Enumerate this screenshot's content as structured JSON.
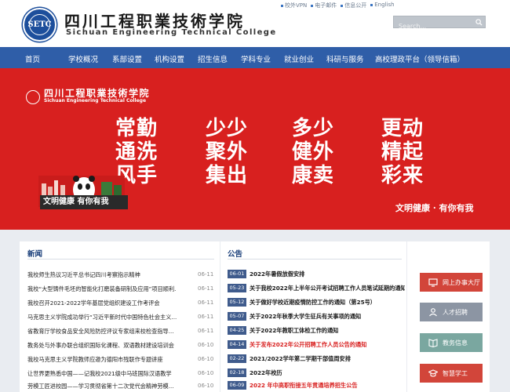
{
  "header": {
    "logo_cn": "四川工程职業技術学院",
    "logo_en": "Sichuan Engineering Technical College",
    "seal_text": "SETC",
    "top_links": [
      "校外VPN",
      "电子邮件",
      "信息公开",
      "English"
    ],
    "search_placeholder": "Search..."
  },
  "nav": {
    "items": [
      "首页",
      "学校概况",
      "系部设置",
      "机构设置",
      "招生信息",
      "学科专业",
      "就业创业",
      "科研与服务",
      "高校理政平台（领导信箱）"
    ]
  },
  "banner": {
    "logo_cn": "四川工程职業技術学院",
    "logo_en": "Sichuan Engineering Technical College",
    "slogan_rows": [
      [
        "常勤",
        "少少",
        "多少",
        "更动"
      ],
      [
        "通洗",
        "聚外",
        "健外",
        "精起"
      ],
      [
        "风手",
        "集出",
        "康卖",
        "彩来"
      ]
    ],
    "caption": "文明健康 有你有我",
    "right_slogan": "文明健康 · 有你有我"
  },
  "news": {
    "title": "新闻",
    "items": [
      {
        "title": "我校师生热议习近平总书记四川考察指示精神",
        "date": "06-11"
      },
      {
        "title": "我校“大型铸件毛坯的智能化打磨装备研制及应用”项目顺利...",
        "date": "06-11"
      },
      {
        "title": "我校召开2021-2022学年基层党组织建设工作考评会",
        "date": "06-11"
      },
      {
        "title": "马克思主义学院成功举行“习近平新时代中国特色社会主义...",
        "date": "06-11"
      },
      {
        "title": "省教育厅学校食品安全风险防控评议专家组来校检查指导...",
        "date": "06-11"
      },
      {
        "title": "教务处与外事办联合组织国际化课程、双语教材建设培训会",
        "date": "06-10"
      },
      {
        "title": "我校马克思主义学院教师应邀为德阳市残联作专题讲座",
        "date": "06-10"
      },
      {
        "title": "让世界更熟悉中国——记我校2021级中马班国际汉语教学",
        "date": "06-10"
      },
      {
        "title": "劳模工匠进校园——学习贯彻省第十二次党代会精神劳模...",
        "date": "06-10"
      }
    ]
  },
  "notices": {
    "title": "公告",
    "items": [
      {
        "date": "06-01",
        "title": "2022年暑假放假安排",
        "highlight": false
      },
      {
        "date": "05-23",
        "title": "关于我校2022年上半年公开考试招聘工作人员笔试延期的通知",
        "highlight": false
      },
      {
        "date": "05-12",
        "title": "关于做好学校近期疫情防控工作的通知（第25号）",
        "highlight": false
      },
      {
        "date": "05-07",
        "title": "关于2022年秋季大学生征兵有关事项的通知",
        "highlight": false
      },
      {
        "date": "04-25",
        "title": "关于2022年教职工体检工作的通知",
        "highlight": false
      },
      {
        "date": "04-14",
        "title": "关于发布2022年公开招聘工作人员公告的通知",
        "highlight": true
      },
      {
        "date": "02-22",
        "title": "2021/2022学年第二学期干部值周安排",
        "highlight": false
      },
      {
        "date": "02-18",
        "title": "2022年校历",
        "highlight": false
      },
      {
        "date": "06-09",
        "title": "2022 年中高职衔接五年贯通培养招生公告",
        "highlight": true
      }
    ]
  },
  "side": {
    "buttons": [
      {
        "label": "网上办事大厅",
        "color": "#d2453a",
        "icon": "monitor-icon"
      },
      {
        "label": "人才招聘",
        "color": "#8c95a3",
        "icon": "person-icon"
      },
      {
        "label": "教务信息",
        "color": "#7aa7a0",
        "icon": "book-icon"
      },
      {
        "label": "智慧学工",
        "color": "#d2453a",
        "icon": "cap-icon"
      }
    ]
  },
  "colors": {
    "nav_bg": "#2f5ea8",
    "banner_red": "#d8201f",
    "brand_blue": "#1d4f9c"
  }
}
